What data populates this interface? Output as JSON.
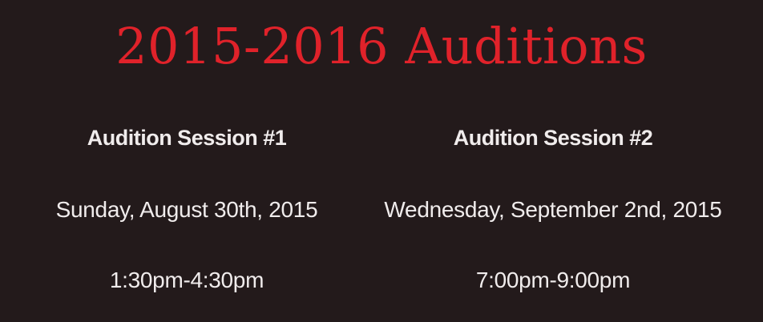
{
  "title": "2015-2016 Auditions",
  "sessions": [
    {
      "heading": "Audition Session #1",
      "date": "Sunday, August 30th, 2015",
      "time": "1:30pm-4:30pm"
    },
    {
      "heading": "Audition Session #2",
      "date": "Wednesday, September 2nd, 2015",
      "time": "7:00pm-9:00pm"
    }
  ],
  "colors": {
    "background": "#231a1b",
    "title": "#e0222a",
    "text": "#f0ecec"
  }
}
